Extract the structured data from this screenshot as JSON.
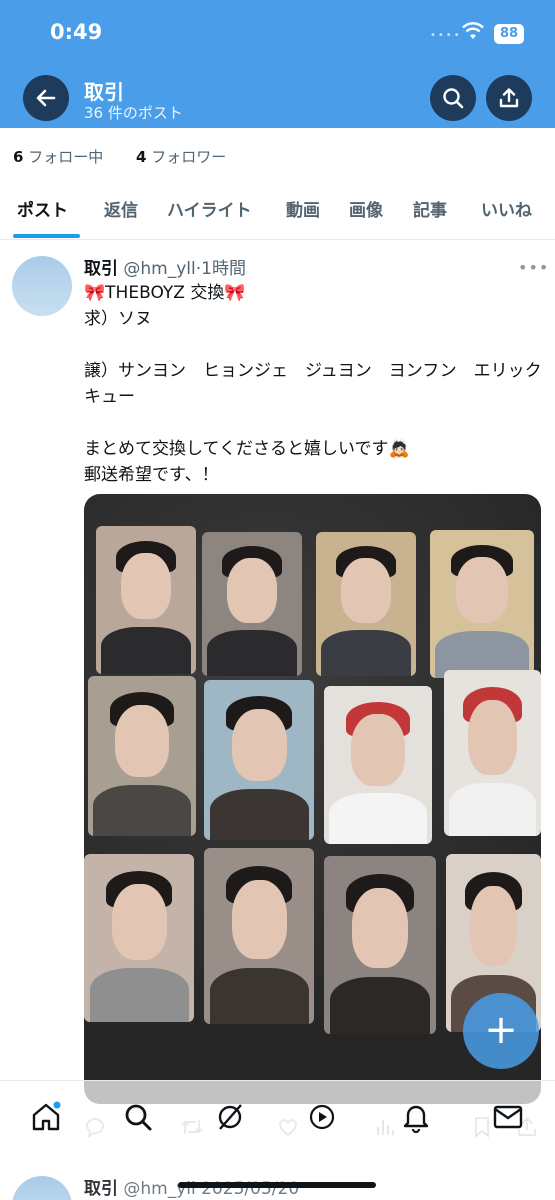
{
  "status_bar": {
    "time": "0:49",
    "battery": "88"
  },
  "header": {
    "title": "取引",
    "subtitle": "36 件のポスト"
  },
  "profile_stats": {
    "following_count": "6",
    "following_label": "フォロー中",
    "followers_count": "4",
    "followers_label": "フォロワー"
  },
  "tabs": [
    {
      "label": "ポスト"
    },
    {
      "label": "返信"
    },
    {
      "label": "ハイライト"
    },
    {
      "label": "動画"
    },
    {
      "label": "画像"
    },
    {
      "label": "記事"
    },
    {
      "label": "いいね"
    }
  ],
  "post": {
    "name": "取引",
    "handle": "@hm_yll",
    "separator": "·",
    "time": "1時間",
    "lines": [
      "🎀THEBOYZ 交換🎀",
      "求）ソヌ",
      "",
      "譲）サンヨン　ヒョンジェ　ジュヨン　ヨンフン　エリック　キュー",
      "",
      "まとめて交換してくださると嬉しいです🙇🏻",
      "郵送希望です、！"
    ]
  },
  "fab_label": "+",
  "next_post": {
    "name": "取引",
    "handle": "@hm_yll",
    "date": "2025/05/20"
  },
  "colors": {
    "header": "#4a9de8",
    "accent": "#1d9bf0",
    "header_button": "#1f3b5b"
  },
  "icons": {
    "back": "arrow-left-icon",
    "search": "search-icon",
    "share": "share-icon",
    "nav": [
      "home-icon",
      "search-icon",
      "grok-icon",
      "notifications-icon",
      "messages-icon"
    ],
    "actions": [
      "reply-icon",
      "retweet-icon",
      "like-icon",
      "views-icon",
      "bookmark-icon",
      "share-icon"
    ]
  }
}
